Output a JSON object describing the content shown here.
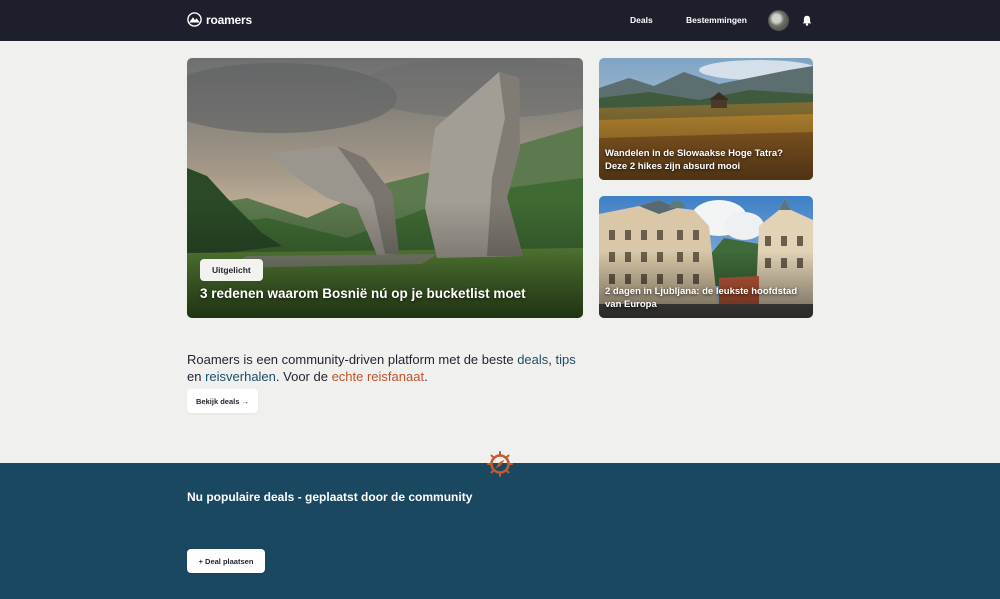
{
  "nav": {
    "logo_text": "roamers",
    "links": [
      "Deals",
      "Bestemmingen"
    ]
  },
  "hero": {
    "main": {
      "badge": "Uitgelicht",
      "title": "3 redenen waarom Bosnië nú op je bucketlist moet"
    },
    "side": [
      {
        "title": "Wandelen in de Slowaakse Hoge Tatra? Deze 2 hikes zijn absurd mooi"
      },
      {
        "title": "2 dagen in Ljubljana: de leukste hoofdstad van Europa"
      }
    ]
  },
  "intro": {
    "part1": "Roamers is een community-driven platform met de beste ",
    "link_deals": "deals",
    "sep1": ", ",
    "link_tips": "tips",
    "part2": " en ",
    "link_stories": "reisverhalen",
    "part3": ". Voor de ",
    "accent": "echte reisfanaat",
    "part4": ".",
    "button": "Bekijk deals →"
  },
  "deals_section": {
    "title": "Nu populaire deals - geplaatst door de community",
    "button": "+ Deal plaatsen"
  },
  "colors": {
    "nav_bg": "#1d1f2c",
    "page_bg": "#f0f1ee",
    "deals_bg": "#1a4860",
    "link": "#1e4e68",
    "accent": "#c0532a"
  },
  "icons": [
    "mountain-logo-icon",
    "bell-icon",
    "compass-icon"
  ]
}
